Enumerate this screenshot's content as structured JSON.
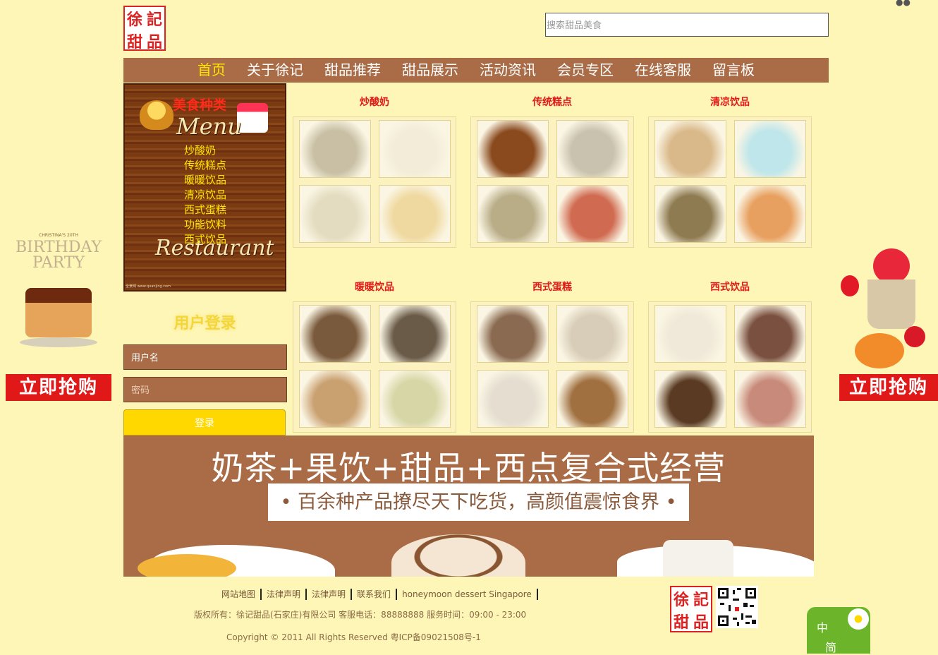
{
  "header": {
    "logo_text": [
      "徐",
      "記",
      "甜",
      "品"
    ],
    "search_placeholder": "搜索甜品美食"
  },
  "nav": {
    "items": [
      "首页",
      "关于徐记",
      "甜品推荐",
      "甜品展示",
      "活动资讯",
      "会员专区",
      "在线客服",
      "留言板"
    ],
    "active_index": 0
  },
  "menu_board": {
    "title": "美食种类",
    "word_top": "Menu",
    "word_bottom": "Restaurant",
    "items": [
      "炒酸奶",
      "传统糕点",
      "暖暖饮品",
      "清凉饮品",
      "西式蛋糕",
      "功能饮料",
      "西式饮品"
    ],
    "footer_text": "全景网 www.quanjing.com"
  },
  "login": {
    "title": "用户登录",
    "username_placeholder": "用户名",
    "password_placeholder": "密码",
    "button": "登录"
  },
  "categories": [
    {
      "title": "炒酸奶",
      "thumb_colors": [
        "#c8bfa4",
        "#f2ecd8",
        "#e3dcc0",
        "#efd9a0"
      ]
    },
    {
      "title": "传统糕点",
      "thumb_colors": [
        "#8a4a1e",
        "#c9c2ae",
        "#b9ad88",
        "#d06a50"
      ]
    },
    {
      "title": "清凉饮品",
      "thumb_colors": [
        "#d9b98a",
        "#bfe6ea",
        "#8e7b52",
        "#e8a060"
      ]
    },
    {
      "title": "暖暖饮品",
      "thumb_colors": [
        "#7a5a3c",
        "#6a5a48",
        "#c9a070",
        "#d7d6a6"
      ]
    },
    {
      "title": "西式蛋糕",
      "thumb_colors": [
        "#8a6a50",
        "#d8cdb8",
        "#e4ddd0",
        "#a07040"
      ]
    },
    {
      "title": "西式饮品",
      "thumb_colors": [
        "#f0e8d8",
        "#7a5040",
        "#5a3a22",
        "#c88a7a"
      ]
    }
  ],
  "banner": {
    "headline": "奶茶+果饮+甜品+西点复合式经营",
    "subline": "• 百余种产品撩尽天下吃货，高颜值震惊食界 •"
  },
  "side_ads": {
    "left_caption": "BIRTHDAY PARTY",
    "left_small": "CHRISTINA'S 20TH",
    "buy_label": "立即抢购"
  },
  "footer": {
    "links": [
      "网站地图",
      "法律声明",
      "法律声明",
      "联系我们",
      "honeymoon dessert Singapore"
    ],
    "company_line": "版权所有：徐记甜品(石家庄)有限公司 客服电话：88888888 服务时间：09:00 - 23:00",
    "copyright_line": "Copyright © 2011 All Rights Reserved 粤ICP备09021508号-1",
    "lang_top": "中",
    "lang_bottom": "简"
  },
  "colors": {
    "page_bg": "#fef6b6",
    "nav_bg": "#a96c46",
    "nav_active": "#ffe600",
    "category_title": "#e01818",
    "login_button": "#ffd800",
    "buy_button": "#e01818"
  }
}
